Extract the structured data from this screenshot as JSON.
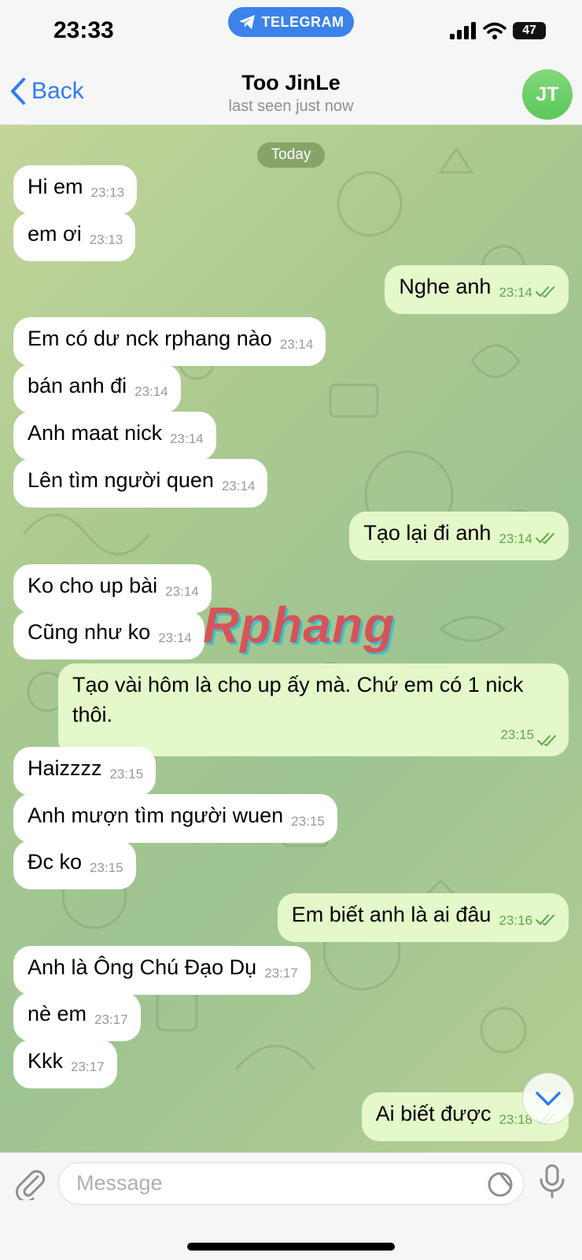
{
  "status_bar": {
    "time": "23:33",
    "app_pill": "TELEGRAM",
    "battery": "47"
  },
  "header": {
    "back_label": "Back",
    "contact_name": "Too JinLe",
    "last_seen": "last seen just now",
    "avatar_initials": "JT"
  },
  "chat": {
    "date_label": "Today",
    "watermark": "Rphang",
    "messages": [
      {
        "dir": "in",
        "text": "Hi em",
        "time": "23:13"
      },
      {
        "dir": "in",
        "text": "em ơi",
        "time": "23:13"
      },
      {
        "dir": "out",
        "text": "Nghe anh",
        "time": "23:14"
      },
      {
        "dir": "in",
        "text": "Em có dư nck rphang nào",
        "time": "23:14"
      },
      {
        "dir": "in",
        "text": "bán anh đi",
        "time": "23:14"
      },
      {
        "dir": "in",
        "text": "Anh maat nick",
        "time": "23:14"
      },
      {
        "dir": "in",
        "text": "Lên tìm người quen",
        "time": "23:14"
      },
      {
        "dir": "out",
        "text": "Tạo lại đi anh",
        "time": "23:14"
      },
      {
        "dir": "in",
        "text": "Ko cho up bài",
        "time": "23:14"
      },
      {
        "dir": "in",
        "text": "Cũng như ko",
        "time": "23:14"
      },
      {
        "dir": "out",
        "text": "Tạo vài hôm là cho up ấy mà. Chứ em có 1 nick thôi.",
        "time": "23:15"
      },
      {
        "dir": "in",
        "text": "Haizzzz",
        "time": "23:15"
      },
      {
        "dir": "in",
        "text": "Anh mượn tìm người wuen",
        "time": "23:15"
      },
      {
        "dir": "in",
        "text": "Đc ko",
        "time": "23:15"
      },
      {
        "dir": "out",
        "text": "Em biết anh là ai đâu",
        "time": "23:16"
      },
      {
        "dir": "in",
        "text": "Anh là Ông Chú Đạo Dụ",
        "time": "23:17"
      },
      {
        "dir": "in",
        "text": "nè em",
        "time": "23:17"
      },
      {
        "dir": "in",
        "text": "Kkk",
        "time": "23:17"
      },
      {
        "dir": "out",
        "text": "Ai biết được",
        "time": "23:18"
      }
    ]
  },
  "composer": {
    "placeholder": "Message"
  },
  "icons": {
    "back": "chevron-left-icon",
    "telegram": "telegram-plane-icon",
    "attach": "paperclip-icon",
    "sticker": "sticker-icon",
    "mic": "microphone-icon",
    "scroll_down": "chevron-down-icon",
    "read": "double-check-icon"
  },
  "colors": {
    "accent": "#2f7cf6",
    "outgoing_bubble": "#e4f8c9",
    "incoming_bubble": "#ffffff",
    "avatar": "#5cc65a",
    "read_check": "#5fa84c"
  }
}
